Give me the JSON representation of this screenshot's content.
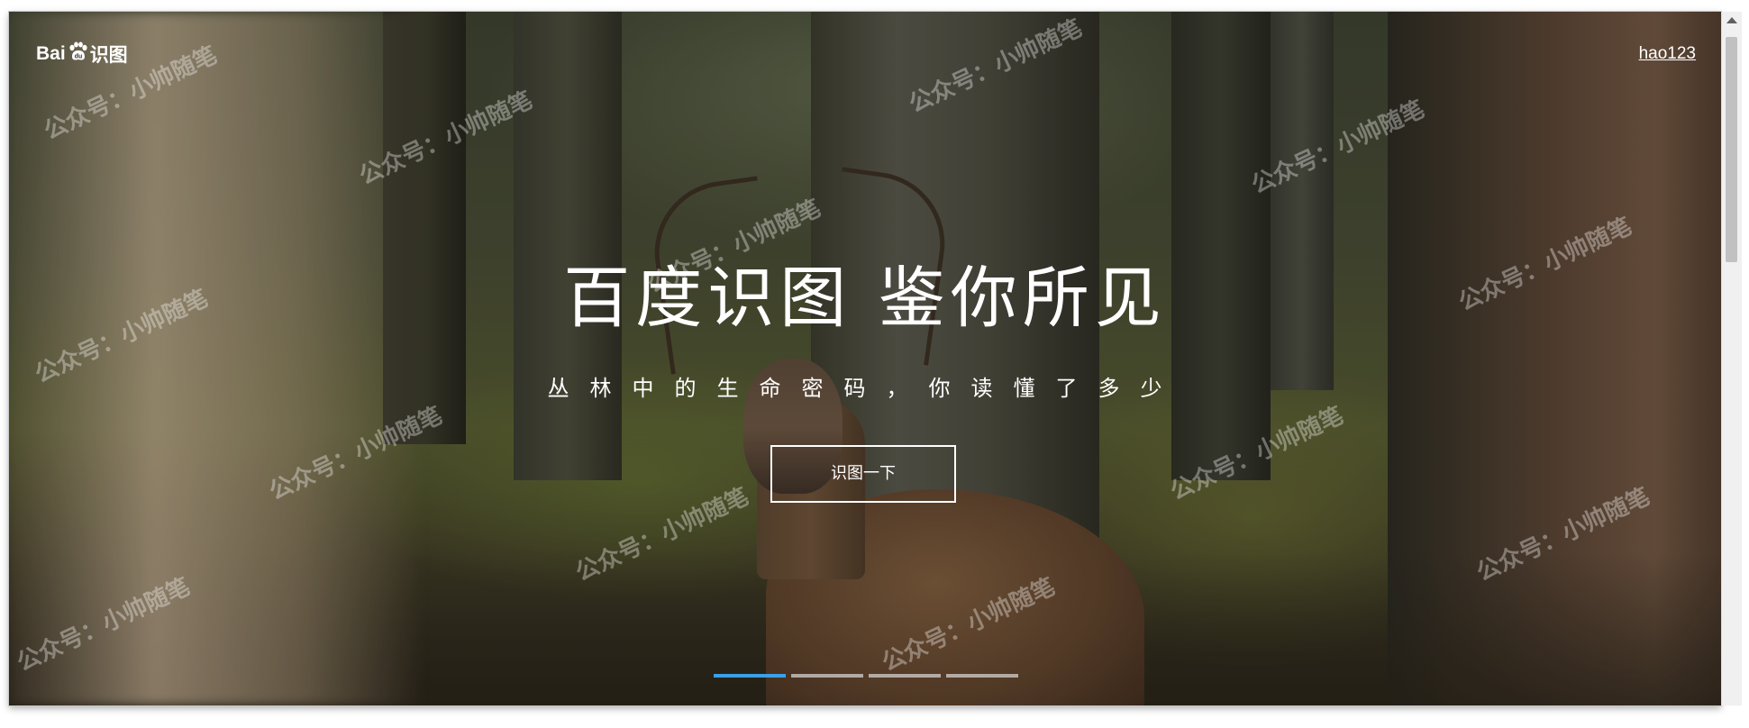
{
  "header": {
    "logo_latin": "Bai",
    "logo_cn": "识图",
    "top_link": "hao123"
  },
  "hero": {
    "title": "百度识图  鉴你所见",
    "subtitle": "丛林中的生命密码，你读懂了多少",
    "cta_label": "识图一下"
  },
  "carousel": {
    "slide_count": 4,
    "active_index": 0,
    "active_color": "#3aa0e8"
  },
  "watermark": "公众号：小帅随笔",
  "icons": [
    "baidu-paw-icon"
  ]
}
